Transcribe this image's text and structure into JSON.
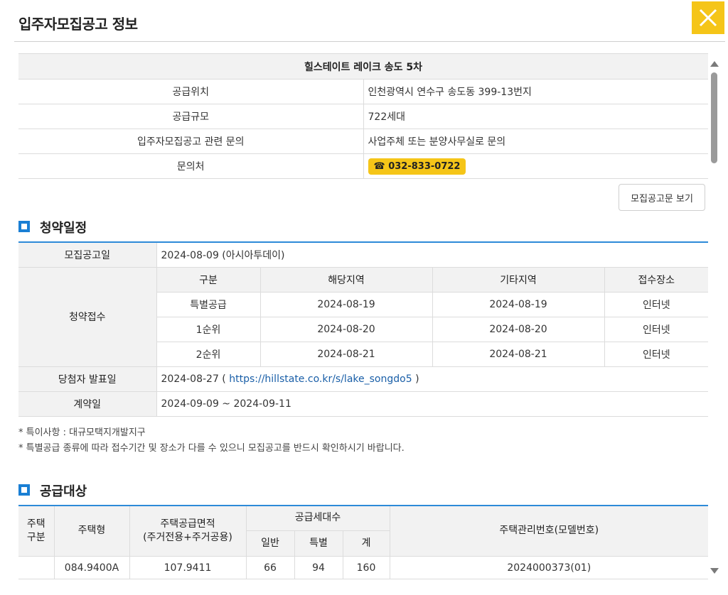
{
  "header": {
    "title": "입주자모집공고 정보",
    "close_icon": "close-icon"
  },
  "complex": {
    "name": "힐스테이트 레이크 송도 5차",
    "rows": [
      {
        "label": "공급위치",
        "value": "인천광역시 연수구 송도동 399-13번지"
      },
      {
        "label": "공급규모",
        "value": "722세대"
      },
      {
        "label": "입주자모집공고 관련 문의",
        "value": "사업주체 또는 분양사무실로 문의"
      }
    ],
    "contact_label": "문의처",
    "contact_phone": "☎ 032-833-0722"
  },
  "notice_button": "모집공고문 보기",
  "schedule": {
    "title": "청약일정",
    "announce_label": "모집공고일",
    "announce_value": "2024-08-09 (아시아투데이)",
    "apply_label": "청약접수",
    "apply_headers": [
      "구분",
      "해당지역",
      "기타지역",
      "접수장소"
    ],
    "apply_rows": [
      [
        "특별공급",
        "2024-08-19",
        "2024-08-19",
        "인터넷"
      ],
      [
        "1순위",
        "2024-08-20",
        "2024-08-20",
        "인터넷"
      ],
      [
        "2순위",
        "2024-08-21",
        "2024-08-21",
        "인터넷"
      ]
    ],
    "winner_label": "당첨자 발표일",
    "winner_date": "2024-08-27 (",
    "winner_link": "https://hillstate.co.kr/s/lake_songdo5",
    "winner_close": ")",
    "contract_label": "계약일",
    "contract_value": "2024-09-09 ~ 2024-09-11"
  },
  "notes": [
    "* 특이사항 : 대규모택지개발지구",
    "* 특별공급 종류에 따라 접수기간 및 장소가 다를 수 있으니 모집공고를 반드시 확인하시기 바랍니다."
  ],
  "supply": {
    "title": "공급대상",
    "headers": {
      "house_div_1": "주택",
      "house_div_2": "구분",
      "house_type": "주택형",
      "area_1": "주택공급면적",
      "area_2": "(주거전용+주거공용)",
      "units": "공급세대수",
      "general": "일반",
      "special": "특별",
      "total": "계",
      "mgmt_no": "주택관리번호(모델번호)"
    },
    "rows": [
      {
        "div": "",
        "type": "084.9400A",
        "area": "107.9411",
        "general": "66",
        "special": "94",
        "total": "160",
        "mgmt": "2024000373(01)"
      }
    ]
  }
}
